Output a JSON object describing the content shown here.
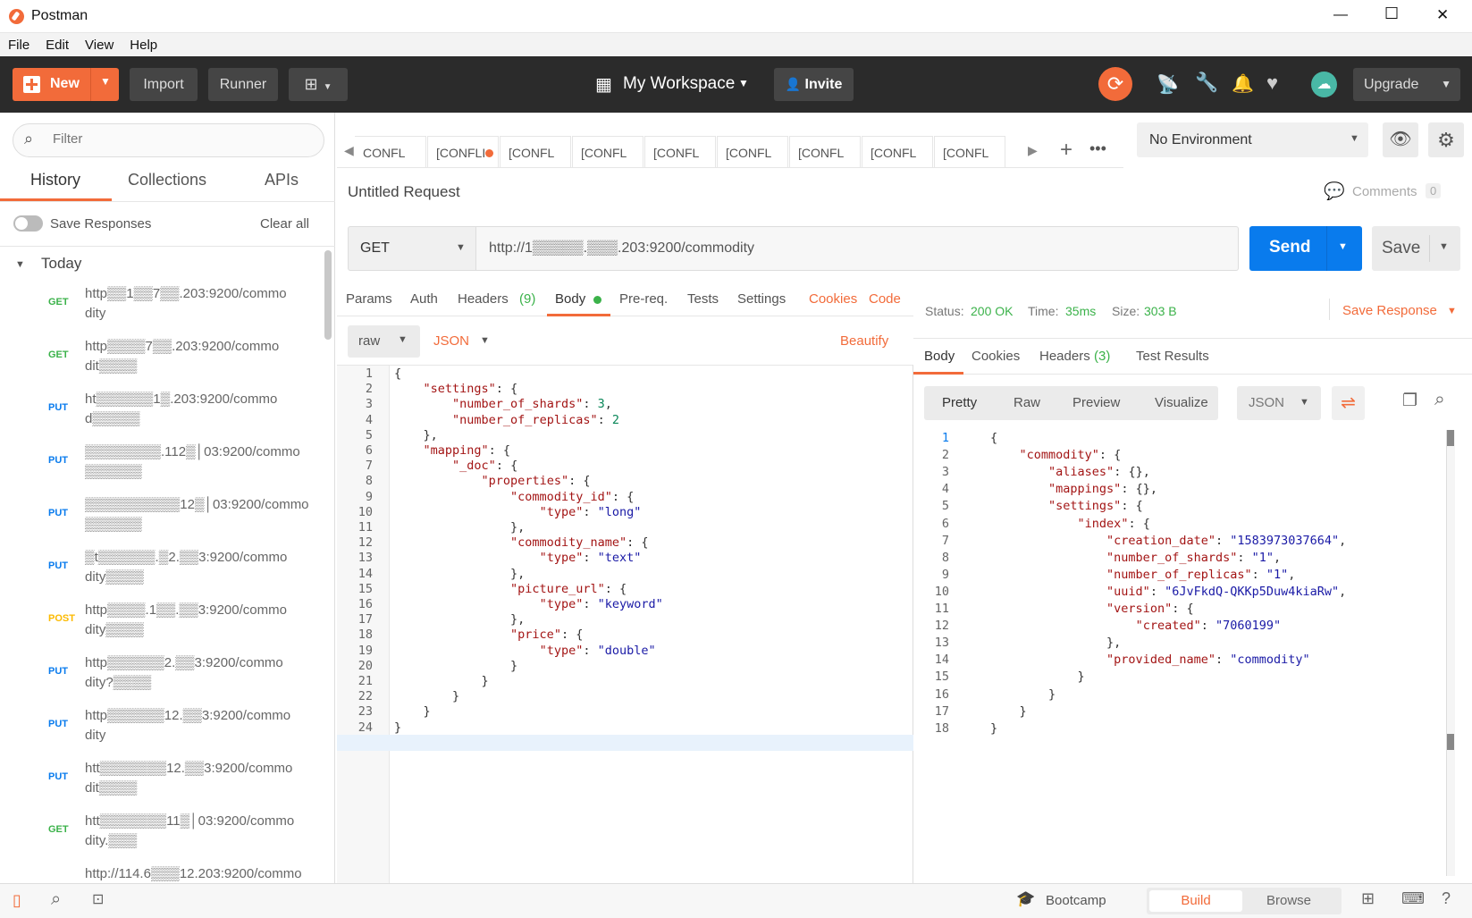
{
  "window": {
    "title": "Postman",
    "minimize": "—",
    "maximize": "☐",
    "close": "✕"
  },
  "menu": [
    "File",
    "Edit",
    "View",
    "Help"
  ],
  "header": {
    "new_label": "New",
    "import_label": "Import",
    "runner_label": "Runner",
    "workspace_label": "My Workspace",
    "invite_label": "Invite",
    "upgrade_label": "Upgrade"
  },
  "sidebar": {
    "filter_placeholder": "Filter",
    "tabs": [
      "History",
      "Collections",
      "APIs"
    ],
    "save_responses_label": "Save Responses",
    "clear_all_label": "Clear all",
    "group_label": "Today",
    "items": [
      {
        "method": "GET",
        "color": "#3bb24a",
        "line1": "http▒▒1▒▒7▒▒.203:9200/commo",
        "line2": "dity"
      },
      {
        "method": "GET",
        "color": "#3bb24a",
        "line1": "http▒▒▒▒7▒▒.203:9200/commo",
        "line2": "dit▒▒▒▒"
      },
      {
        "method": "PUT",
        "color": "#097bed",
        "line1": "ht▒▒▒▒▒▒1▒.203:9200/commo",
        "line2": "d▒▒▒▒▒"
      },
      {
        "method": "PUT",
        "color": "#097bed",
        "line1": "▒▒▒▒▒▒▒▒.112▒│03:9200/commo",
        "line2": "▒▒▒▒▒▒"
      },
      {
        "method": "PUT",
        "color": "#097bed",
        "line1": "▒▒▒▒▒▒▒▒▒▒12▒│03:9200/commo",
        "line2": "▒▒▒▒▒▒"
      },
      {
        "method": "PUT",
        "color": "#097bed",
        "line1": "▒t▒▒▒▒▒▒.▒2.▒▒3:9200/commo",
        "line2": "dity▒▒▒▒"
      },
      {
        "method": "POST",
        "color": "#fcba00",
        "line1": "http▒▒▒▒.1▒▒.▒▒3:9200/commo",
        "line2": "dity▒▒▒▒"
      },
      {
        "method": "PUT",
        "color": "#097bed",
        "line1": "http▒▒▒▒▒▒2.▒▒3:9200/commo",
        "line2": "dity?▒▒▒▒"
      },
      {
        "method": "PUT",
        "color": "#097bed",
        "line1": "http▒▒▒▒▒▒12.▒▒3:9200/commo",
        "line2": "dity"
      },
      {
        "method": "PUT",
        "color": "#097bed",
        "line1": "htt▒▒▒▒▒▒▒12.▒▒3:9200/commo",
        "line2": "dit▒▒▒▒"
      },
      {
        "method": "GET",
        "color": "#3bb24a",
        "line1": "htt▒▒▒▒▒▒▒11▒│03:9200/commo",
        "line2": "dity.▒▒▒"
      }
    ],
    "partial_item": "http://114.6▒▒▒12.203:9200/commo"
  },
  "request_tabs": [
    "CONFL",
    "[CONFLI",
    "[CONFL",
    "[CONFL",
    "[CONFL",
    "[CONFL",
    "[CONFL",
    "[CONFL",
    "[CONFL"
  ],
  "environment": "No Environment",
  "request": {
    "title": "Untitled Request",
    "comments_label": "Comments",
    "comments_count": "0",
    "method": "GET",
    "url": "http://1▒▒▒▒▒.▒▒▒.203:9200/commodity",
    "send_label": "Send",
    "save_label": "Save"
  },
  "request_subtabs": {
    "params": "Params",
    "auth": "Auth",
    "headers": "Headers",
    "headers_count": "(9)",
    "body": "Body",
    "prereq": "Pre-req.",
    "tests": "Tests",
    "settings": "Settings",
    "cookies": "Cookies",
    "code": "Code"
  },
  "body_opts": {
    "mode": "raw",
    "format": "JSON",
    "beautify": "Beautify"
  },
  "request_body": [
    {
      "n": "1",
      "t": "{"
    },
    {
      "n": "2",
      "t": "    \"settings\": {"
    },
    {
      "n": "3",
      "t": "        \"number_of_shards\": 3,"
    },
    {
      "n": "4",
      "t": "        \"number_of_replicas\": 2"
    },
    {
      "n": "5",
      "t": "    },"
    },
    {
      "n": "6",
      "t": "    \"mapping\": {"
    },
    {
      "n": "7",
      "t": "        \"_doc\": {"
    },
    {
      "n": "8",
      "t": "            \"properties\": {"
    },
    {
      "n": "9",
      "t": "                \"commodity_id\": {"
    },
    {
      "n": "10",
      "t": "                    \"type\": \"long\""
    },
    {
      "n": "11",
      "t": "                },"
    },
    {
      "n": "12",
      "t": "                \"commodity_name\": {"
    },
    {
      "n": "13",
      "t": "                    \"type\": \"text\""
    },
    {
      "n": "14",
      "t": "                },"
    },
    {
      "n": "15",
      "t": "                \"picture_url\": {"
    },
    {
      "n": "16",
      "t": "                    \"type\": \"keyword\""
    },
    {
      "n": "17",
      "t": "                },"
    },
    {
      "n": "18",
      "t": "                \"price\": {"
    },
    {
      "n": "19",
      "t": "                    \"type\": \"double\""
    },
    {
      "n": "20",
      "t": "                }"
    },
    {
      "n": "21",
      "t": "            }"
    },
    {
      "n": "22",
      "t": "        }"
    },
    {
      "n": "23",
      "t": "    }"
    },
    {
      "n": "24",
      "t": "}"
    }
  ],
  "response": {
    "status_label": "Status:",
    "status_value": "200 OK",
    "time_label": "Time:",
    "time_value": "35ms",
    "size_label": "Size:",
    "size_value": "303 B",
    "save_response_label": "Save Response",
    "tabs": {
      "body": "Body",
      "cookies": "Cookies",
      "headers": "Headers",
      "headers_count": "(3)",
      "tests": "Test Results"
    },
    "view_modes": [
      "Pretty",
      "Raw",
      "Preview",
      "Visualize"
    ],
    "format": "JSON",
    "body": [
      {
        "n": "1",
        "t": "{"
      },
      {
        "n": "2",
        "t": "    \"commodity\": {"
      },
      {
        "n": "3",
        "t": "        \"aliases\": {},"
      },
      {
        "n": "4",
        "t": "        \"mappings\": {},"
      },
      {
        "n": "5",
        "t": "        \"settings\": {"
      },
      {
        "n": "6",
        "t": "            \"index\": {"
      },
      {
        "n": "7",
        "t": "                \"creation_date\": \"1583973037664\","
      },
      {
        "n": "8",
        "t": "                \"number_of_shards\": \"1\","
      },
      {
        "n": "9",
        "t": "                \"number_of_replicas\": \"1\","
      },
      {
        "n": "10",
        "t": "                \"uuid\": \"6JvFkdQ-QKKp5Duw4kiaRw\","
      },
      {
        "n": "11",
        "t": "                \"version\": {"
      },
      {
        "n": "12",
        "t": "                    \"created\": \"7060199\""
      },
      {
        "n": "13",
        "t": "                },"
      },
      {
        "n": "14",
        "t": "                \"provided_name\": \"commodity\""
      },
      {
        "n": "15",
        "t": "            }"
      },
      {
        "n": "16",
        "t": "        }"
      },
      {
        "n": "17",
        "t": "    }"
      },
      {
        "n": "18",
        "t": "}"
      }
    ]
  },
  "footer": {
    "bootcamp_label": "Bootcamp",
    "build_label": "Build",
    "browse_label": "Browse"
  },
  "colors": {
    "orange": "#f26b3a",
    "blue": "#097bed",
    "green": "#3bb24a",
    "dark": "#2b2b2b"
  }
}
